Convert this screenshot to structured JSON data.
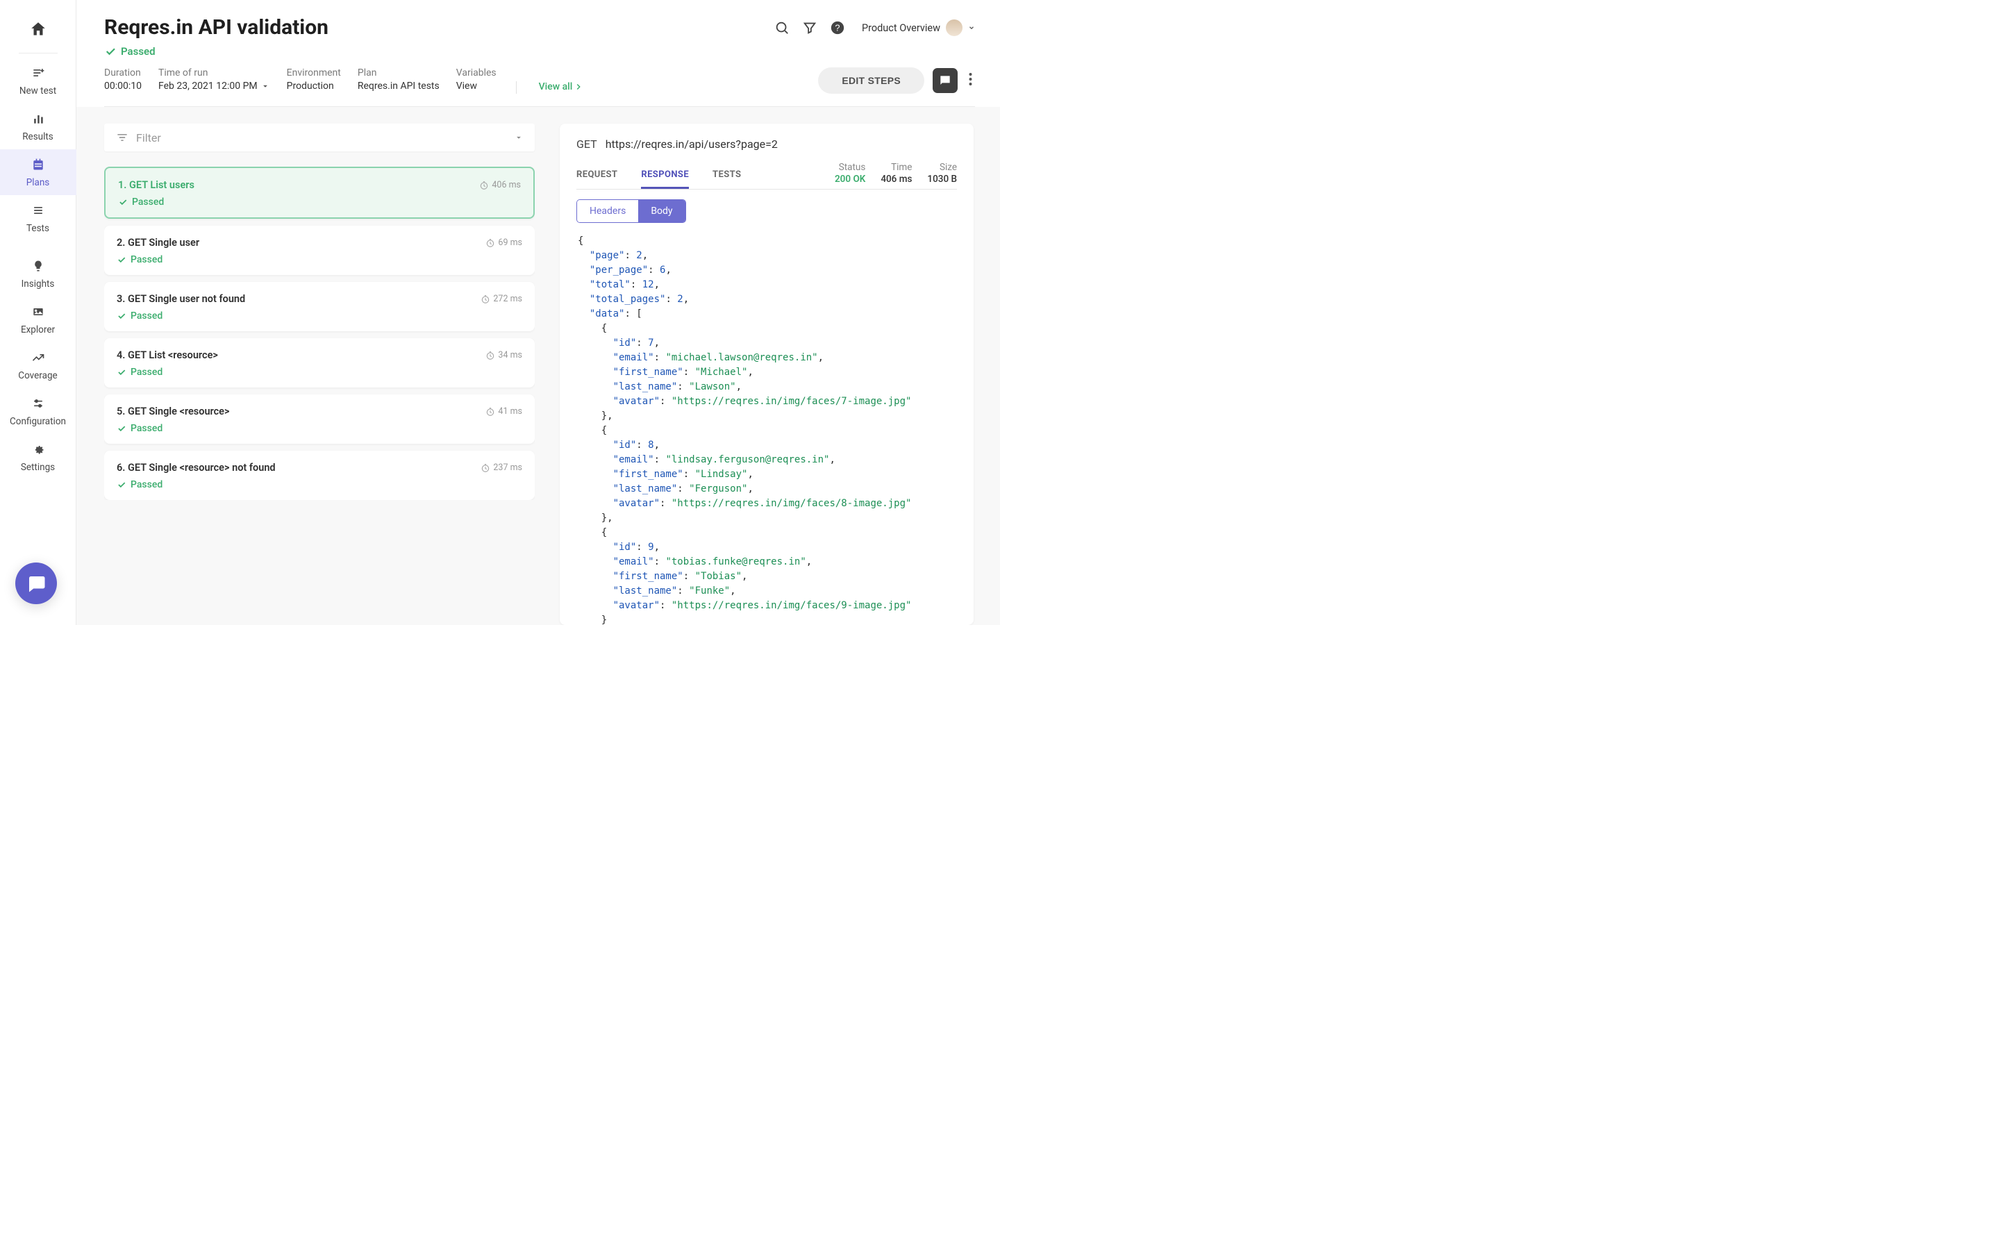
{
  "sidebar": {
    "items": [
      {
        "id": "new-test",
        "label": "New test"
      },
      {
        "id": "results",
        "label": "Results"
      },
      {
        "id": "plans",
        "label": "Plans"
      },
      {
        "id": "tests",
        "label": "Tests"
      },
      {
        "id": "insights",
        "label": "Insights"
      },
      {
        "id": "explorer",
        "label": "Explorer"
      },
      {
        "id": "coverage",
        "label": "Coverage"
      },
      {
        "id": "configuration",
        "label": "Configuration"
      },
      {
        "id": "settings",
        "label": "Settings"
      }
    ],
    "active": "plans"
  },
  "header": {
    "title": "Reqres.in API validation",
    "status": "Passed",
    "meta": {
      "duration_label": "Duration",
      "duration_value": "00:00:10",
      "time_label": "Time of run",
      "time_value": "Feb 23, 2021 12:00 PM",
      "env_label": "Environment",
      "env_value": "Production",
      "plan_label": "Plan",
      "plan_value": "Reqres.in API tests",
      "vars_label": "Variables",
      "vars_value": "View",
      "view_all": "View all"
    },
    "product_link": "Product Overview",
    "edit_button": "EDIT STEPS"
  },
  "filter": {
    "placeholder": "Filter"
  },
  "steps": [
    {
      "idx": "1.",
      "name": "GET List users",
      "ms": "406 ms",
      "status": "Passed",
      "selected": true
    },
    {
      "idx": "2.",
      "name": "GET Single user",
      "ms": "69 ms",
      "status": "Passed"
    },
    {
      "idx": "3.",
      "name": "GET Single user not found",
      "ms": "272 ms",
      "status": "Passed"
    },
    {
      "idx": "4.",
      "name": "GET List <resource>",
      "ms": "34 ms",
      "status": "Passed"
    },
    {
      "idx": "5.",
      "name": "GET Single <resource>",
      "ms": "41 ms",
      "status": "Passed"
    },
    {
      "idx": "6.",
      "name": "GET Single <resource> not found",
      "ms": "237 ms",
      "status": "Passed"
    }
  ],
  "request": {
    "method": "GET",
    "url": "https://reqres.in/api/users?page=2",
    "tabs": {
      "request": "REQUEST",
      "response": "RESPONSE",
      "tests": "TESTS"
    },
    "active_tab": "response",
    "stats": {
      "status_label": "Status",
      "status_value": "200 OK",
      "time_label": "Time",
      "time_value": "406 ms",
      "size_label": "Size",
      "size_value": "1030 B"
    },
    "seg": {
      "headers": "Headers",
      "body": "Body",
      "active": "body"
    },
    "body": {
      "page": 2,
      "per_page": 6,
      "total": 12,
      "total_pages": 2,
      "data": [
        {
          "id": 7,
          "email": "michael.lawson@reqres.in",
          "first_name": "Michael",
          "last_name": "Lawson",
          "avatar": "https://reqres.in/img/faces/7-image.jpg"
        },
        {
          "id": 8,
          "email": "lindsay.ferguson@reqres.in",
          "first_name": "Lindsay",
          "last_name": "Ferguson",
          "avatar": "https://reqres.in/img/faces/8-image.jpg"
        },
        {
          "id": 9,
          "email": "tobias.funke@reqres.in",
          "first_name": "Tobias",
          "last_name": "Funke",
          "avatar": "https://reqres.in/img/faces/9-image.jpg"
        }
      ]
    }
  }
}
